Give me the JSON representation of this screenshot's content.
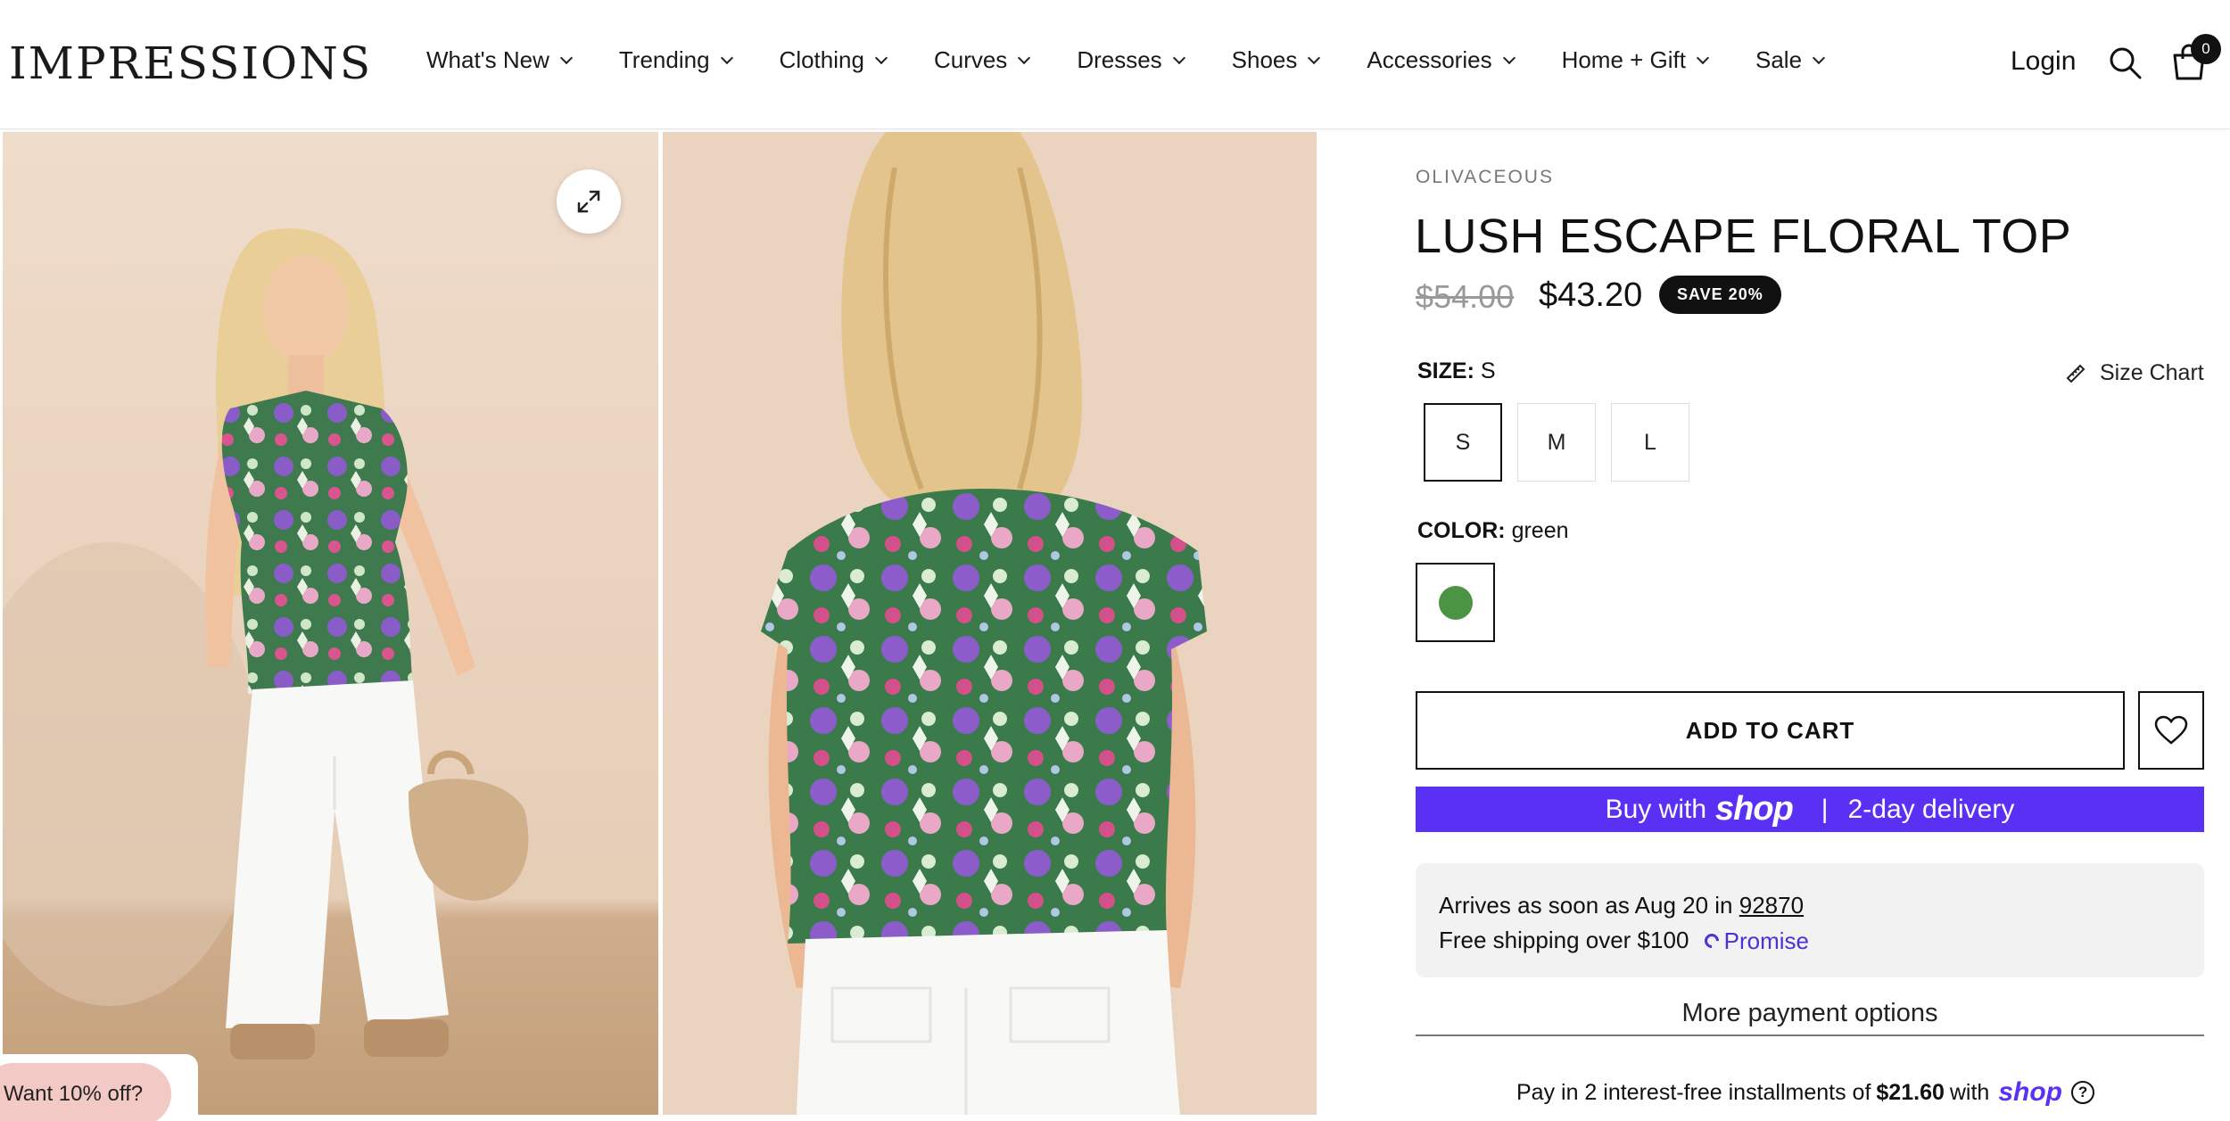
{
  "header": {
    "logo": "IMPRESSIONS",
    "nav": [
      {
        "label": "What's New"
      },
      {
        "label": "Trending"
      },
      {
        "label": "Clothing"
      },
      {
        "label": "Curves"
      },
      {
        "label": "Dresses"
      },
      {
        "label": "Shoes"
      },
      {
        "label": "Accessories"
      },
      {
        "label": "Home + Gift"
      },
      {
        "label": "Sale"
      }
    ],
    "login": "Login",
    "cart_count": "0",
    "icons": [
      "search-icon",
      "cart-icon",
      "chevron-down-icon"
    ]
  },
  "gallery": {
    "expand_icon": "expand-icon",
    "promo_label": "Want 10% off?"
  },
  "product": {
    "vendor": "OLIVACEOUS",
    "title": "LUSH ESCAPE FLORAL TOP",
    "price_original": "$54.00",
    "price_sale": "$43.20",
    "save_badge": "SAVE 20%",
    "size": {
      "label": "SIZE:",
      "selected": "S",
      "options": [
        "S",
        "M",
        "L"
      ],
      "size_chart": "Size Chart"
    },
    "color": {
      "label": "COLOR:",
      "selected": "green",
      "swatch": "#4a9444"
    },
    "add_to_cart": "ADD TO CART",
    "shop_pay": {
      "prefix": "Buy with",
      "brand": "shop",
      "separator": "|",
      "delivery": "2-day delivery",
      "color": "#5a31f4"
    },
    "delivery": {
      "arrives_text": "Arrives as soon as Aug 20 in",
      "zip": "92870",
      "shipping": "Free shipping over $100",
      "promise": "Promise"
    },
    "more_payment": "More payment options",
    "installments": {
      "prefix": "Pay in 2 interest-free installments of",
      "amount": "$21.60",
      "mid": "with",
      "brand": "shop"
    }
  }
}
